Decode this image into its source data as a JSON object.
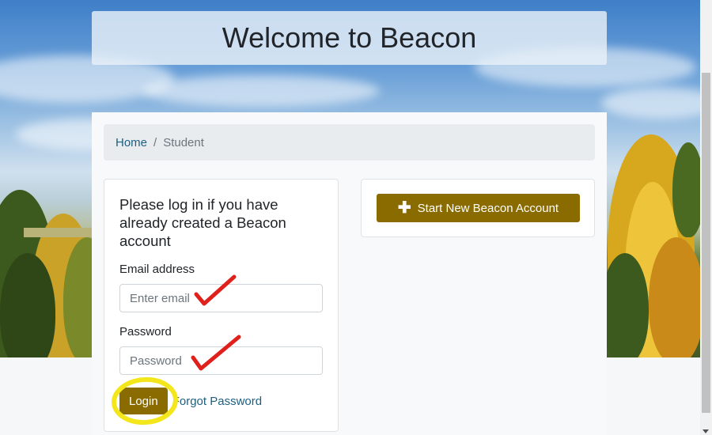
{
  "page": {
    "title": "Welcome to Beacon"
  },
  "breadcrumb": {
    "home": "Home",
    "separator": "/",
    "current": "Student"
  },
  "login": {
    "heading": "Please log in if you have already created a Beacon account",
    "email_label": "Email address",
    "email_placeholder": "Enter email",
    "password_label": "Password",
    "password_placeholder": "Password",
    "login_button": "Login",
    "forgot_link": "Forgot Password"
  },
  "account": {
    "start_button": "Start New Beacon Account",
    "start_icon": "plus-icon"
  },
  "colors": {
    "brand_button": "#8a6b00",
    "link": "#1d5f80",
    "annotation_check": "#e0201b",
    "annotation_highlight": "#f3e61a"
  }
}
